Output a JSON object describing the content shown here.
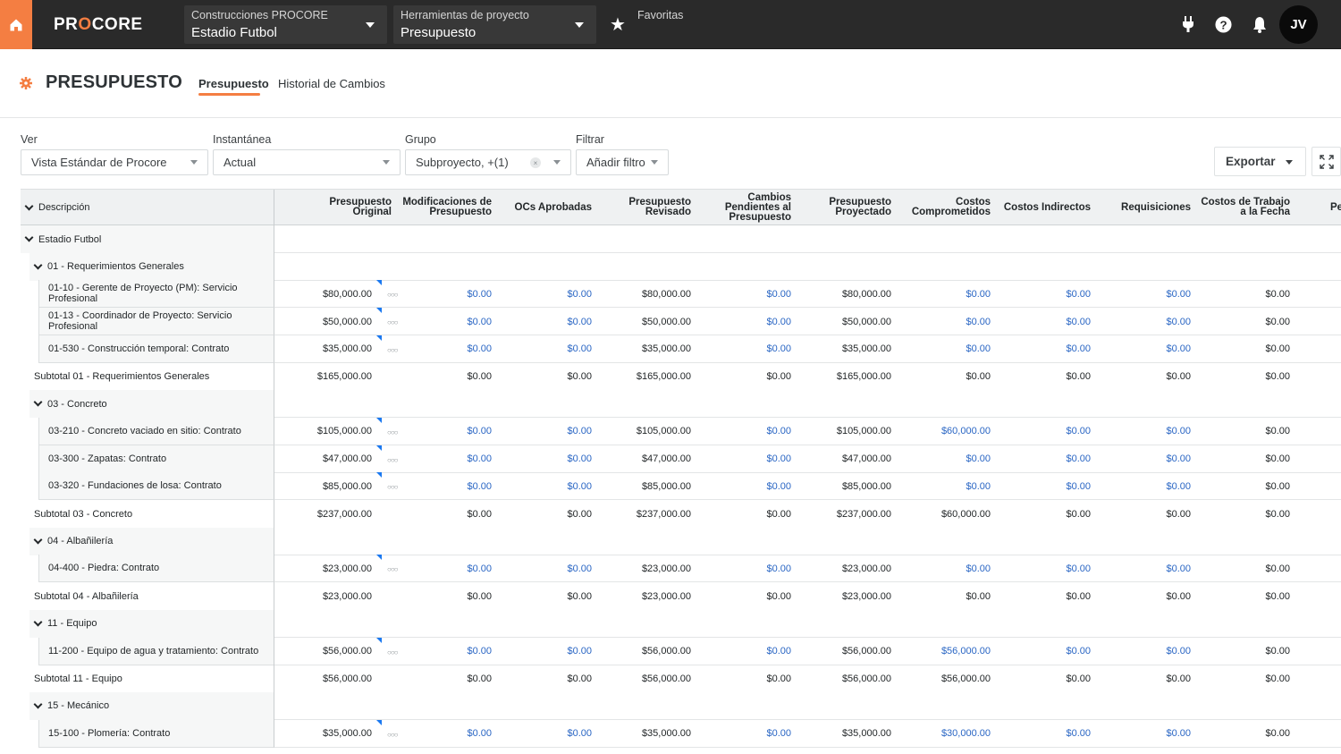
{
  "topnav": {
    "logo_text_a": "PR",
    "logo_text_o": "O",
    "logo_text_b": "CORE",
    "company_picker": {
      "label": "Construcciones PROCORE",
      "value": "Estadio Futbol"
    },
    "tools_picker": {
      "label": "Herramientas de proyecto",
      "value": "Presupuesto"
    },
    "favorites_label": "Favoritas",
    "icons": [
      "home-icon",
      "star-icon",
      "plug-icon",
      "help-icon",
      "bell-icon"
    ],
    "avatar_initials": "JV"
  },
  "page": {
    "title": "PRESUPUESTO",
    "tabs": [
      {
        "label": "Presupuesto",
        "active": true
      },
      {
        "label": "Historial de Cambios",
        "active": false
      }
    ]
  },
  "filters": {
    "ver": {
      "label": "Ver",
      "value": "Vista Estándar de Procore"
    },
    "instantanea": {
      "label": "Instantánea",
      "value": "Actual"
    },
    "grupo": {
      "label": "Grupo",
      "value": "Subproyecto, +(1)",
      "clear": "×"
    },
    "filtrar": {
      "label": "Filtrar",
      "value": "Añadir filtro"
    },
    "export_label": "Exportar"
  },
  "accent_color": "#f47e42",
  "link_color": "#2a66c4",
  "table": {
    "description_header": "Descripción",
    "columns": [
      [
        "Presupuesto Original"
      ],
      [
        "Modificaciones de",
        "Presupuesto"
      ],
      [
        "OCs Aprobadas"
      ],
      [
        "Presupuesto",
        "Revisado"
      ],
      [
        "Cambios",
        "Pendientes al",
        "Presupuesto"
      ],
      [
        "Presupuesto",
        "Proyectado"
      ],
      [
        "Costos",
        "Comprometidos"
      ],
      [
        "Costos Indirectos"
      ],
      [
        "Requisiciones"
      ],
      [
        "Costos de Trabajo",
        "a la Fecha"
      ],
      [
        "Pe"
      ]
    ],
    "rows": [
      {
        "type": "group",
        "level": 0,
        "label": "Estadio Futbol"
      },
      {
        "type": "group",
        "level": 1,
        "label": "01 - Requerimientos Generales"
      },
      {
        "type": "item",
        "label": "01-10 - Gerente de Proyecto (PM): Servicio Profesional",
        "values": [
          "$80,000.00",
          "$0.00",
          "$0.00",
          "$80,000.00",
          "$0.00",
          "$80,000.00",
          "$0.00",
          "$0.00",
          "$0.00",
          "$0.00"
        ]
      },
      {
        "type": "item",
        "label": "01-13 - Coordinador de Proyecto: Servicio Profesional",
        "values": [
          "$50,000.00",
          "$0.00",
          "$0.00",
          "$50,000.00",
          "$0.00",
          "$50,000.00",
          "$0.00",
          "$0.00",
          "$0.00",
          "$0.00"
        ]
      },
      {
        "type": "item",
        "label": "01-530 - Construcción temporal: Contrato",
        "values": [
          "$35,000.00",
          "$0.00",
          "$0.00",
          "$35,000.00",
          "$0.00",
          "$35,000.00",
          "$0.00",
          "$0.00",
          "$0.00",
          "$0.00"
        ]
      },
      {
        "type": "subtotal",
        "label": "Subtotal 01 - Requerimientos Generales",
        "values": [
          "$165,000.00",
          "$0.00",
          "$0.00",
          "$165,000.00",
          "$0.00",
          "$165,000.00",
          "$0.00",
          "$0.00",
          "$0.00",
          "$0.00"
        ]
      },
      {
        "type": "group",
        "level": 1,
        "label": "03 - Concreto"
      },
      {
        "type": "item",
        "label": "03-210 - Concreto vaciado en sitio: Contrato",
        "values": [
          "$105,000.00",
          "$0.00",
          "$0.00",
          "$105,000.00",
          "$0.00",
          "$105,000.00",
          "$60,000.00",
          "$0.00",
          "$0.00",
          "$0.00"
        ]
      },
      {
        "type": "item",
        "label": "03-300 - Zapatas: Contrato",
        "values": [
          "$47,000.00",
          "$0.00",
          "$0.00",
          "$47,000.00",
          "$0.00",
          "$47,000.00",
          "$0.00",
          "$0.00",
          "$0.00",
          "$0.00"
        ]
      },
      {
        "type": "item",
        "label": "03-320 - Fundaciones de losa: Contrato",
        "values": [
          "$85,000.00",
          "$0.00",
          "$0.00",
          "$85,000.00",
          "$0.00",
          "$85,000.00",
          "$0.00",
          "$0.00",
          "$0.00",
          "$0.00"
        ]
      },
      {
        "type": "subtotal",
        "label": "Subtotal 03 - Concreto",
        "values": [
          "$237,000.00",
          "$0.00",
          "$0.00",
          "$237,000.00",
          "$0.00",
          "$237,000.00",
          "$60,000.00",
          "$0.00",
          "$0.00",
          "$0.00"
        ]
      },
      {
        "type": "group",
        "level": 1,
        "label": "04 - Albañilería"
      },
      {
        "type": "item",
        "label": "04-400 - Piedra: Contrato",
        "values": [
          "$23,000.00",
          "$0.00",
          "$0.00",
          "$23,000.00",
          "$0.00",
          "$23,000.00",
          "$0.00",
          "$0.00",
          "$0.00",
          "$0.00"
        ]
      },
      {
        "type": "subtotal",
        "label": "Subtotal 04 - Albañilería",
        "values": [
          "$23,000.00",
          "$0.00",
          "$0.00",
          "$23,000.00",
          "$0.00",
          "$23,000.00",
          "$0.00",
          "$0.00",
          "$0.00",
          "$0.00"
        ]
      },
      {
        "type": "group",
        "level": 1,
        "label": "11 - Equipo"
      },
      {
        "type": "item",
        "label": "11-200 - Equipo de agua y tratamiento: Contrato",
        "values": [
          "$56,000.00",
          "$0.00",
          "$0.00",
          "$56,000.00",
          "$0.00",
          "$56,000.00",
          "$56,000.00",
          "$0.00",
          "$0.00",
          "$0.00"
        ]
      },
      {
        "type": "subtotal",
        "label": "Subtotal 11 - Equipo",
        "values": [
          "$56,000.00",
          "$0.00",
          "$0.00",
          "$56,000.00",
          "$0.00",
          "$56,000.00",
          "$56,000.00",
          "$0.00",
          "$0.00",
          "$0.00"
        ]
      },
      {
        "type": "group",
        "level": 1,
        "label": "15 - Mecánico"
      },
      {
        "type": "item",
        "label": "15-100 - Plomería: Contrato",
        "values": [
          "$35,000.00",
          "$0.00",
          "$0.00",
          "$35,000.00",
          "$0.00",
          "$35,000.00",
          "$30,000.00",
          "$0.00",
          "$0.00",
          "$0.00"
        ]
      }
    ]
  }
}
